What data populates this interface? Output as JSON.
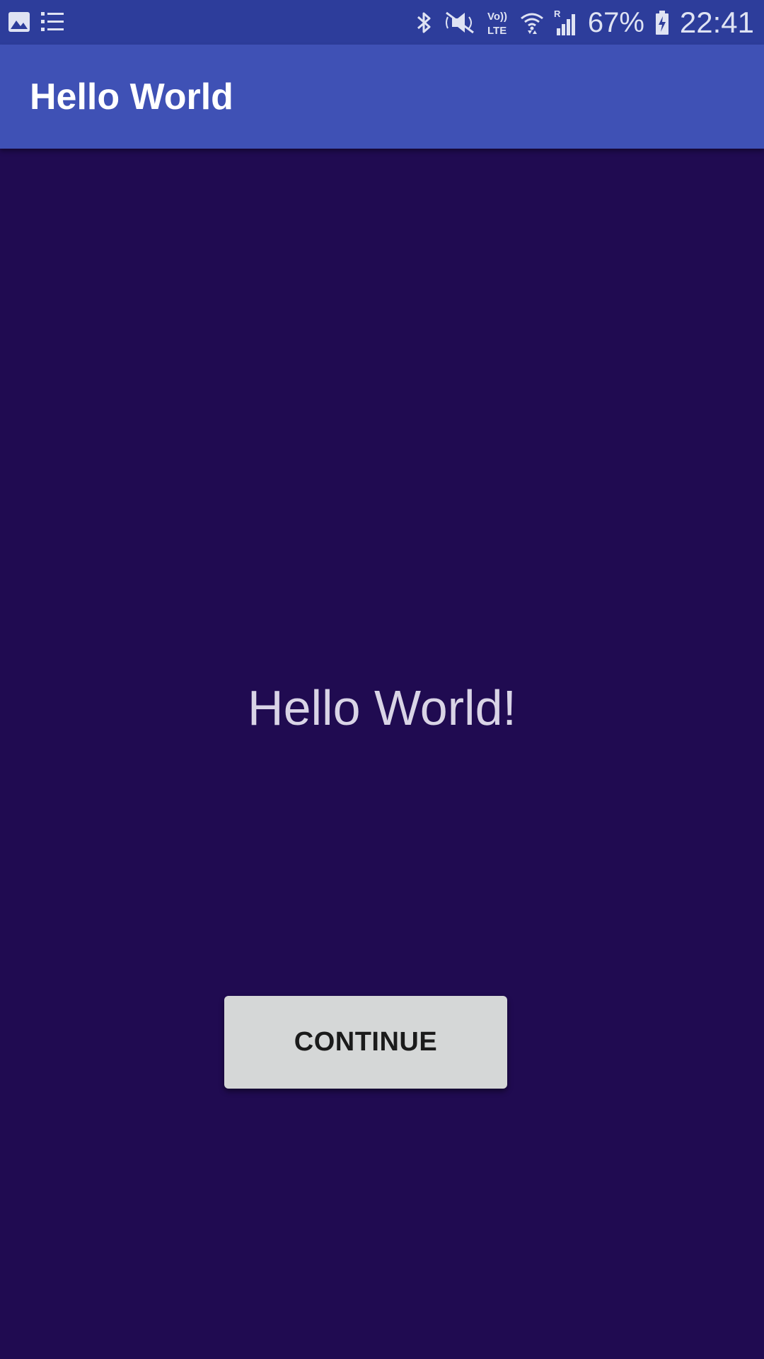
{
  "status_bar": {
    "left_icons": [
      "image-icon",
      "list-icon"
    ],
    "right_icons": [
      "bluetooth-icon",
      "mute-icon",
      "volte-icon",
      "wifi-icon",
      "signal-icon",
      "battery-icon"
    ],
    "volte_top": "Vo))",
    "volte_bottom": "LTE",
    "roaming": "R",
    "battery_percent": "67%",
    "time": "22:41",
    "background": "#2d3d9b"
  },
  "app_bar": {
    "title": "Hello World",
    "background": "#3f51b5"
  },
  "main": {
    "message": "Hello World!",
    "continue_label": "CONTINUE",
    "background": "#200b51"
  }
}
